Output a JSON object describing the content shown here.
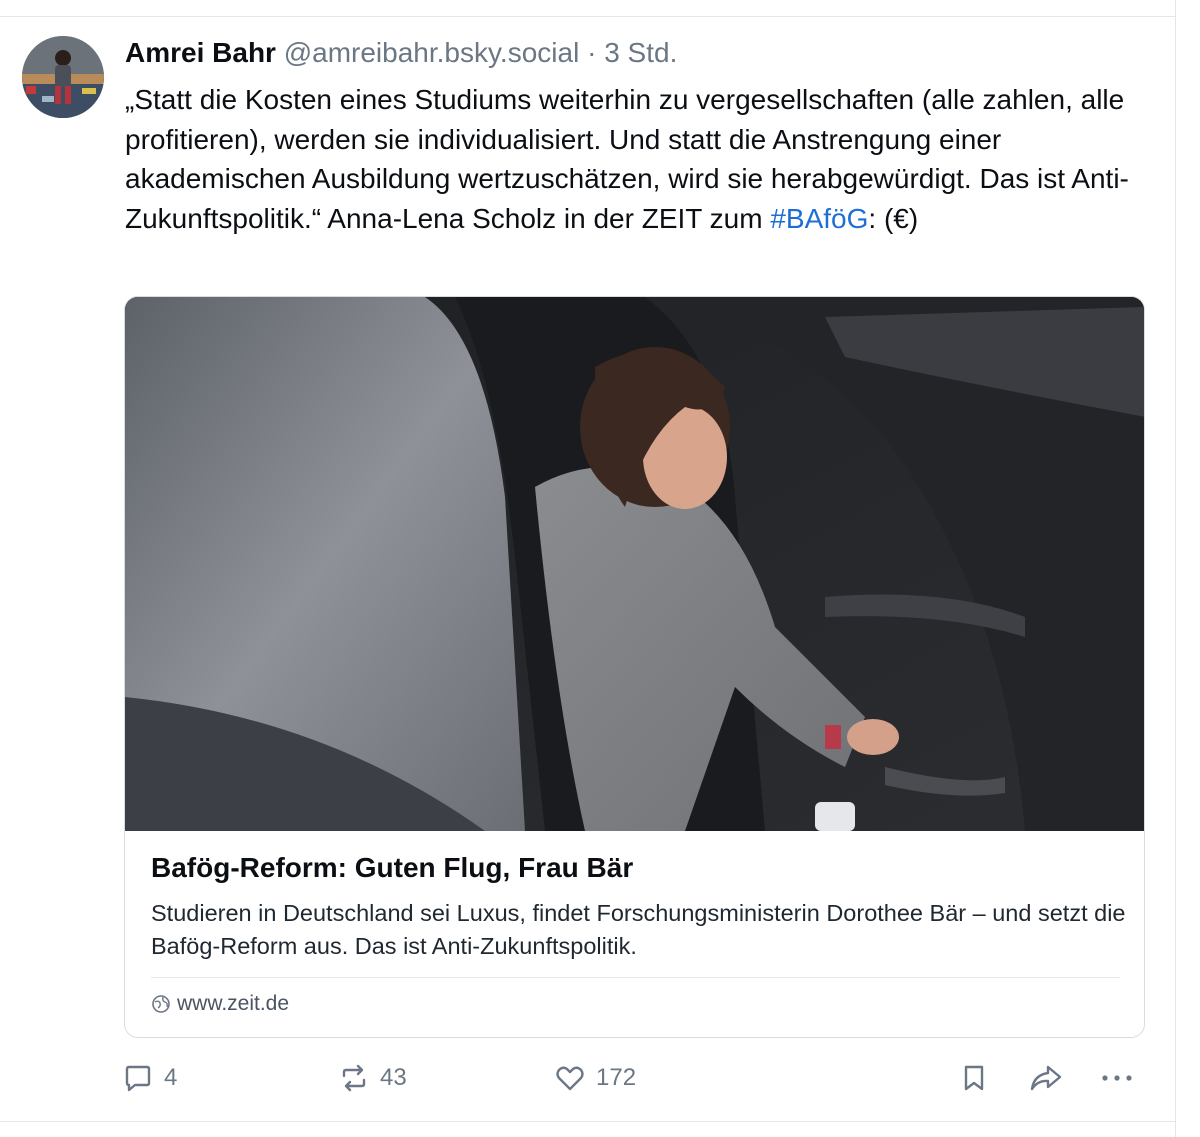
{
  "post": {
    "author_name": "Amrei Bahr",
    "handle": "@amreibahr.bsky.social",
    "separator": "·",
    "time": "3 Std.",
    "text_main": "„Statt die Kosten eines Studiums weiterhin zu vergesellschaften (alle zahlen, alle profitieren), werden sie individualisiert. Und statt die Anstrengung einer akademischen Ausbildung wertzuschätzen, wird sie herabgewürdigt. Das ist Anti-Zukunftspolitik.“ Anna-Lena Scholz in der ZEIT zum ",
    "hashtag": "#BAföG",
    "text_tail": ": (€)",
    "avatar_icon": "person-avatar-photo"
  },
  "link_card": {
    "title": "Bafög-Reform: Guten Flug, Frau Bär",
    "description": "Studieren in Deutschland sei Luxus, findet Forschungsministerin Dorothee Bär – und setzt die Bafög-Reform aus. Das ist Anti-Zukunftspolitik.",
    "domain": "www.zeit.de",
    "domain_icon": "globe-icon",
    "image_alt": "woman-leaning-out-of-car-photo"
  },
  "actions": {
    "reply_count": "4",
    "repost_count": "43",
    "like_count": "172",
    "icons": [
      "reply-icon",
      "repost-icon",
      "like-icon",
      "bookmark-icon",
      "share-icon",
      "more-icon"
    ]
  },
  "colors": {
    "hashtag": "#1d6fd6",
    "muted": "#6b7785",
    "border": "#d7dce1"
  }
}
